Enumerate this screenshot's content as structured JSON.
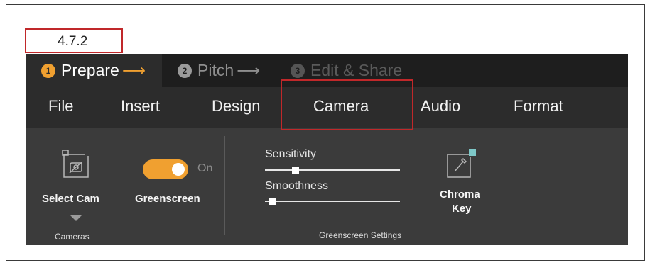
{
  "version_label": "4.7.2",
  "steps": [
    {
      "number": "1",
      "label": "Prepare",
      "arrow": "⟶"
    },
    {
      "number": "2",
      "label": "Pitch",
      "arrow": "⟶"
    },
    {
      "number": "3",
      "label": "Edit & Share"
    }
  ],
  "menu": {
    "items": [
      "File",
      "Insert",
      "Design",
      "Camera",
      "Audio",
      "Format"
    ],
    "active": "Camera"
  },
  "ribbon": {
    "cameras_group": {
      "button_label": "Select Cam",
      "group_label": "Cameras",
      "icon": "camera-off-icon"
    },
    "greenscreen": {
      "label": "Greenscreen",
      "toggle_state": "On",
      "enabled": true
    },
    "settings_group": {
      "group_label": "Greenscreen Settings",
      "sensitivity_label": "Sensitivity",
      "sensitivity_value": 0.2,
      "smoothness_label": "Smoothness",
      "smoothness_value": 0.05,
      "chroma_key_label_1": "Chroma",
      "chroma_key_label_2": "Key",
      "chroma_icon": "eyedropper-icon"
    }
  },
  "colors": {
    "accent": "#f0a030",
    "highlight": "#c0282a",
    "chroma_swatch": "#7ec8c8"
  }
}
